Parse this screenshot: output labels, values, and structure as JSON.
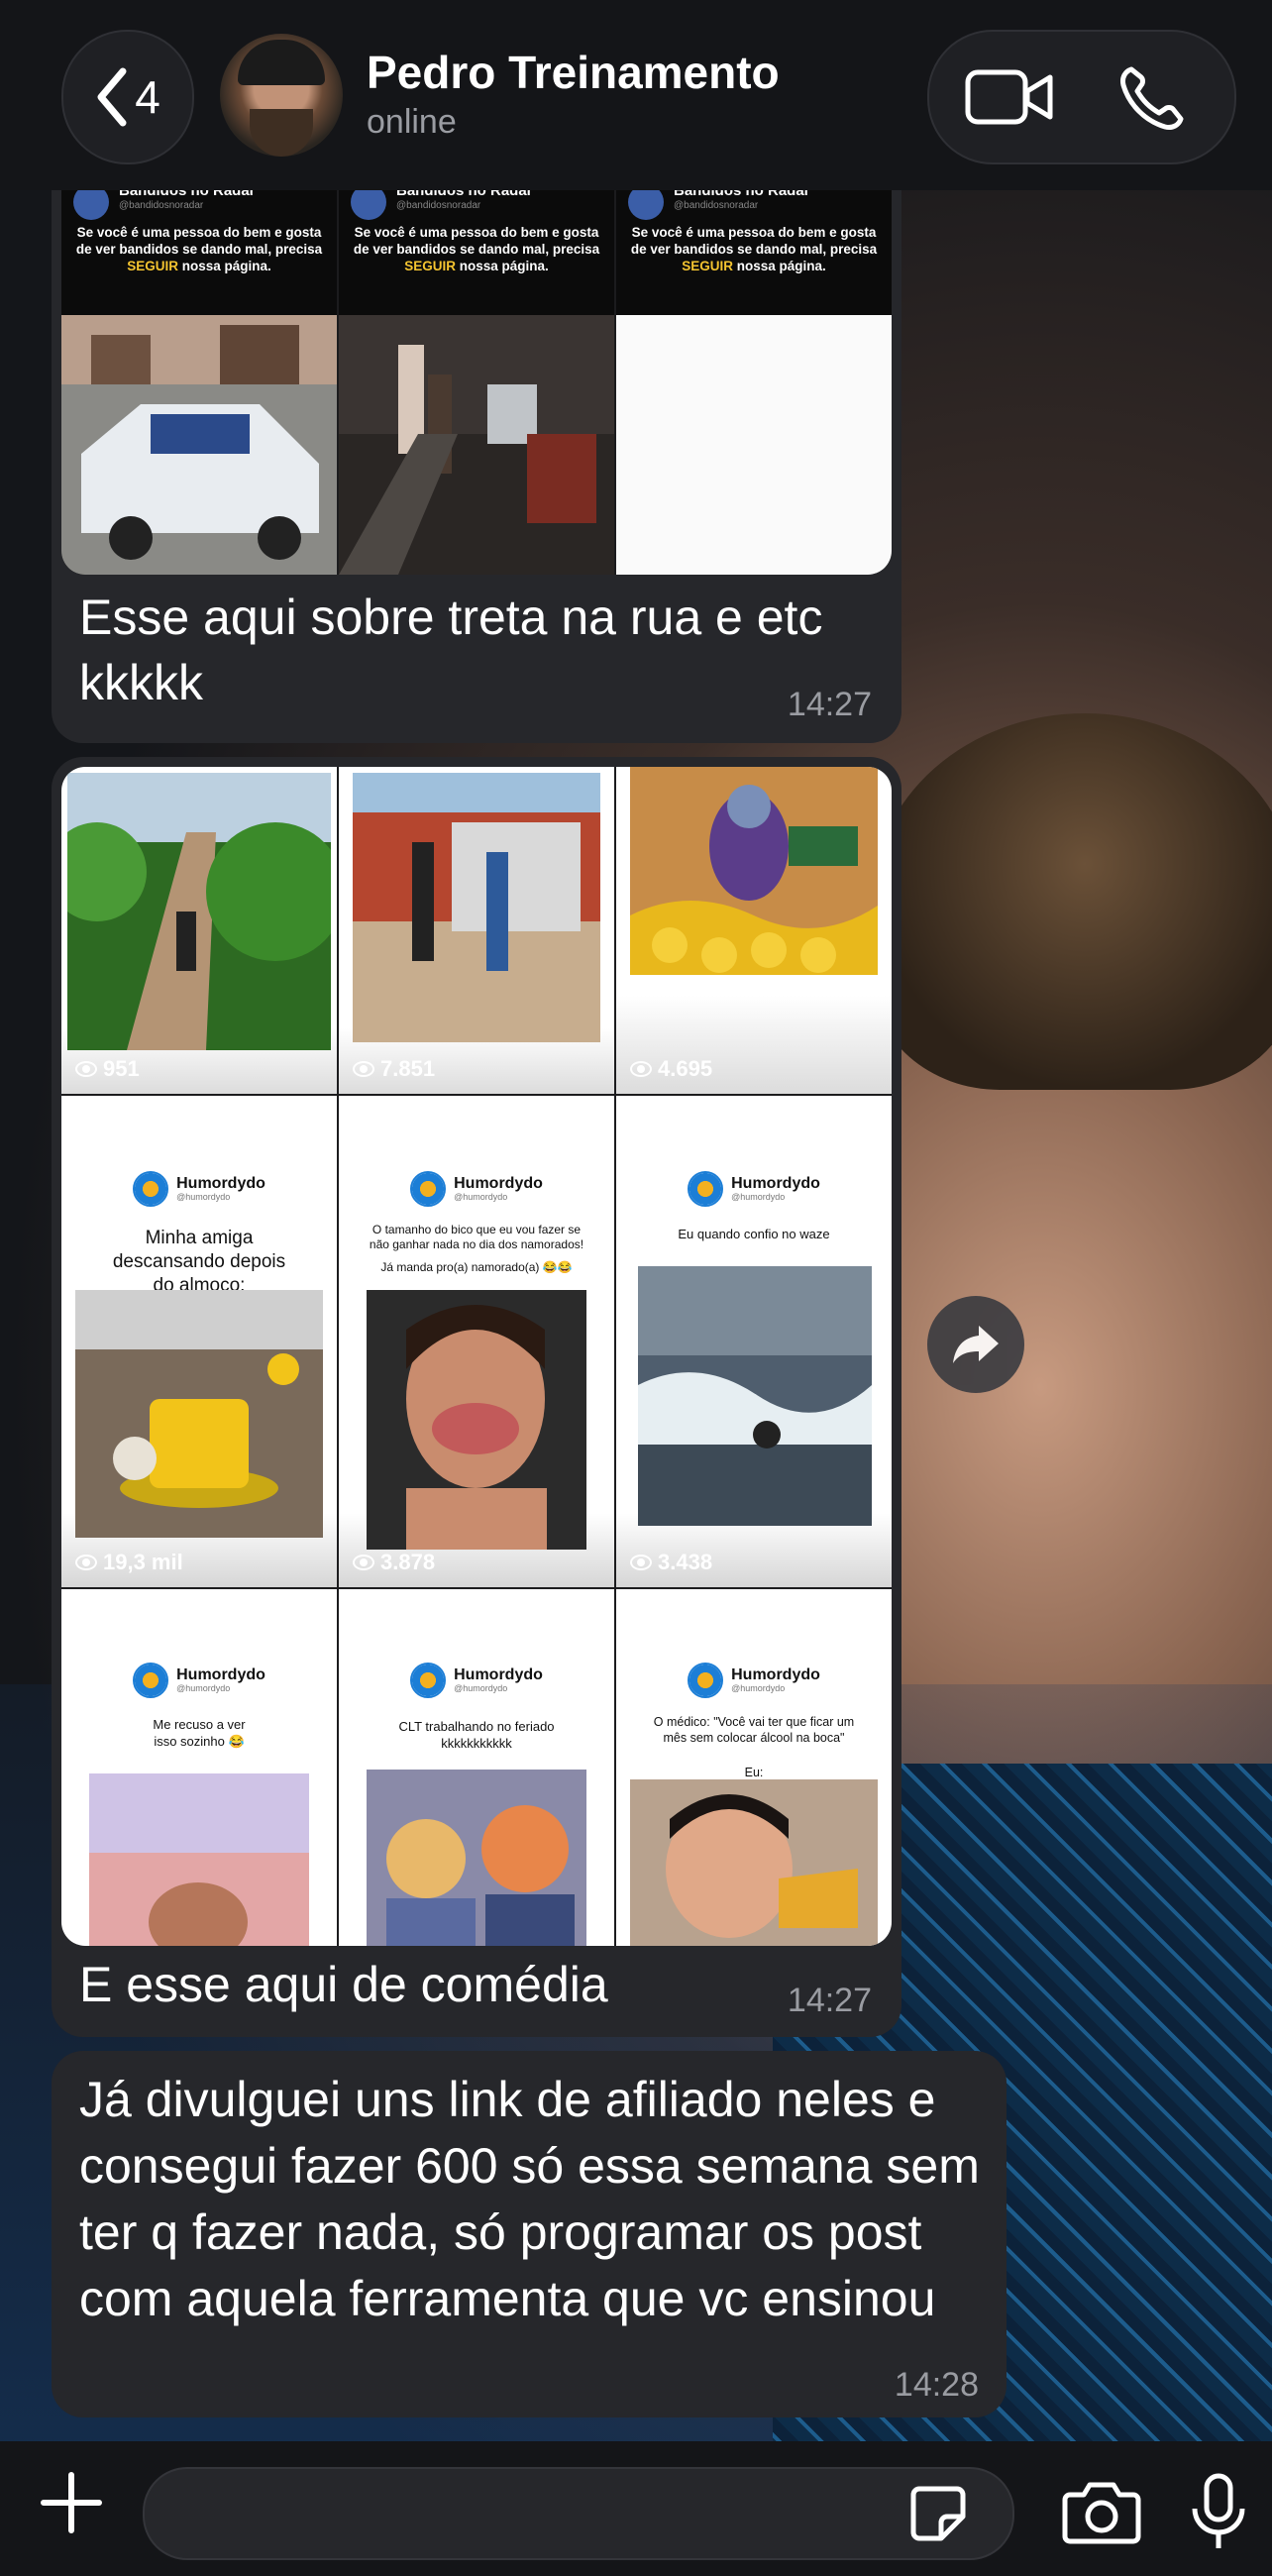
{
  "header": {
    "back_count": "4",
    "contact_name": "Pedro Treinamento",
    "status": "online"
  },
  "messages": [
    {
      "caption": "Esse aqui sobre treta na rua e etc kkkkk",
      "time": "14:27",
      "cards": [
        {
          "title": "Bandidos no Radar",
          "handle": "@bandidosnoradar",
          "text_before": "Se você é uma pessoa do bem e gosta de ver bandidos se dando mal, precisa ",
          "text_highlight": "SEGUIR",
          "text_after": " nossa página."
        },
        {
          "title": "Bandidos no Radar",
          "handle": "@bandidosnoradar",
          "text_before": "Se você é uma pessoa do bem e gosta de ver bandidos se dando mal, precisa ",
          "text_highlight": "SEGUIR",
          "text_after": " nossa página."
        },
        {
          "title": "Bandidos no Radar",
          "handle": "@bandidosnoradar",
          "text_before": "Se você é uma pessoa do bem e gosta de ver bandidos se dando mal, precisa ",
          "text_highlight": "SEGUIR",
          "text_after": " nossa página."
        }
      ]
    },
    {
      "caption": "E esse aqui de comédia",
      "time": "14:27",
      "row1_views": [
        "951",
        "7.851",
        "4.695"
      ],
      "row2": [
        {
          "brand": "Humordydo",
          "handle": "@humordydo",
          "text": "Minha amiga descansando depois do almoço:",
          "views": "19,3 mil"
        },
        {
          "brand": "Humordydo",
          "handle": "@humordydo",
          "text": "O tamanho do bico que eu vou fazer se não ganhar nada no dia dos namorados!",
          "text2": "Já manda pro(a) namorado(a) 😂😂",
          "views": "3.878"
        },
        {
          "brand": "Humordydo",
          "handle": "@humordydo",
          "text": "Eu quando confio no waze",
          "views": "3.438"
        }
      ],
      "row3": [
        {
          "brand": "Humordydo",
          "handle": "@humordydo",
          "text": "Me recuso a ver isso sozinho 😂"
        },
        {
          "brand": "Humordydo",
          "handle": "@humordydo",
          "text": "CLT trabalhando no feriado kkkkkkkkkkk"
        },
        {
          "brand": "Humordydo",
          "handle": "@humordydo",
          "text": "O médico: \"Você vai ter que ficar um mês sem colocar álcool na boca\"",
          "text2": "Eu:"
        }
      ]
    },
    {
      "text": "Já divulguei uns link de afiliado neles e consegui fazer 600 só essa semana sem ter q fazer nada, só programar os post com aquela ferramenta que vc ensinou",
      "time": "14:28"
    }
  ],
  "input": {
    "placeholder": ""
  },
  "colors": {
    "header_bg": "#141518",
    "bubble_bg": "#26272b",
    "time_text": "#9a9ca2"
  }
}
